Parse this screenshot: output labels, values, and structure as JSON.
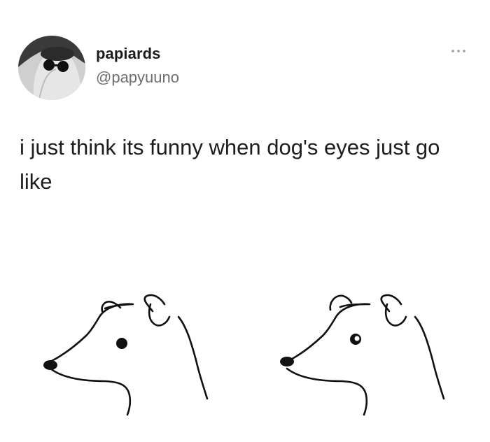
{
  "tweet": {
    "author": {
      "display_name": "papiards",
      "handle": "@papyuuno",
      "avatar_icon": "ghost-with-sunglasses-avatar"
    },
    "more_icon": "more-horizontal-icon",
    "text": "i just think its funny when dog's eyes just go like",
    "media": {
      "description_icons": [
        "dog-head-solid-eye-drawing",
        "dog-head-ring-eye-drawing"
      ]
    }
  }
}
